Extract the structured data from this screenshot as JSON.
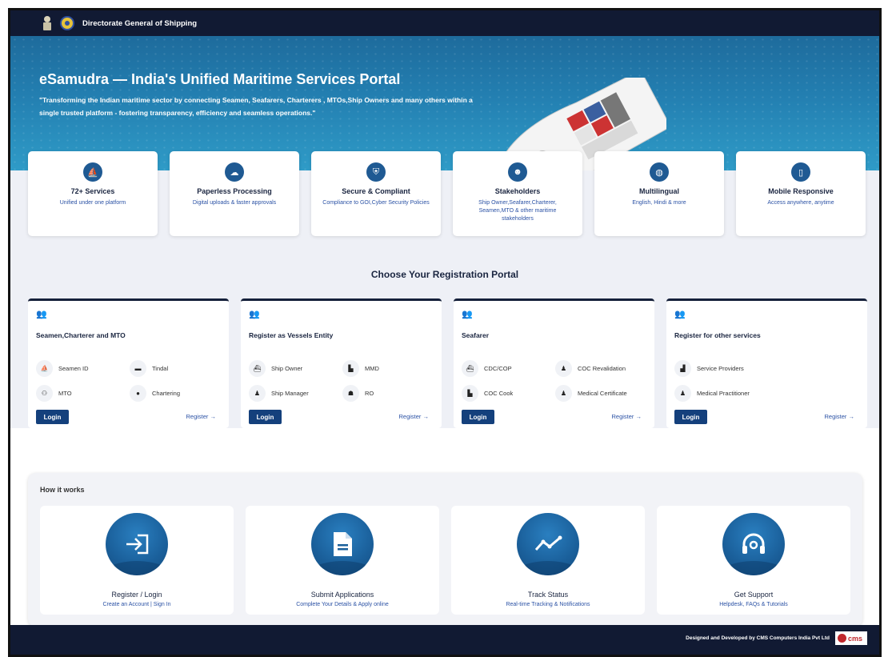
{
  "header": {
    "org_name": "Directorate General of Shipping"
  },
  "hero": {
    "title": "eSamudra — India's Unified Maritime Services Portal",
    "subtitle": "\"Transforming the Indian maritime sector by connecting Seamen, Seafarers, Charterers , MTOs,Ship Owners and many others within a single trusted platform - fostering transparency, efficiency and seamless operations.\""
  },
  "features": [
    {
      "title": "72+ Services",
      "desc": "Unified under one platform",
      "icon": "ship-icon"
    },
    {
      "title": "Paperless Processing",
      "desc": "Digital uploads & faster approvals",
      "icon": "cloud-icon"
    },
    {
      "title": "Secure & Compliant",
      "desc": "Compliance to GOI,Cyber Security Policies",
      "icon": "shield-icon"
    },
    {
      "title": "Stakeholders",
      "desc": "Ship Owner,Seafarer,Charterer, Seamen,MTO & other maritime stakeholders",
      "icon": "people-icon"
    },
    {
      "title": "Multilingual",
      "desc": "English, Hindi & more",
      "icon": "globe-icon"
    },
    {
      "title": "Mobile Responsive",
      "desc": "Access anywhere, anytime",
      "icon": "mobile-icon"
    }
  ],
  "registration": {
    "section_title": "Choose Your Registration Portal",
    "portals": [
      {
        "title": "Seamen,Charterer and MTO",
        "items": [
          "Seamen ID",
          "Tindal",
          "MTO",
          "Chartering"
        ],
        "login": "Login",
        "register": "Register →"
      },
      {
        "title": "Register as Vessels Entity",
        "items": [
          "Ship Owner",
          "MMD",
          "Ship Manager",
          "RO"
        ],
        "login": "Login",
        "register": "Register →"
      },
      {
        "title": "Seafarer",
        "items": [
          "CDC/COP",
          "COC Revalidation",
          "COC Cook",
          "Medical Certificate"
        ],
        "login": "Login",
        "register": "Register →"
      },
      {
        "title": "Register for other services",
        "items": [
          "Service Providers",
          "Medical Practitioner"
        ],
        "login": "Login",
        "register": "Register →"
      }
    ]
  },
  "how_it_works": {
    "title": "How it works",
    "steps": [
      {
        "title": "Register / Login",
        "desc": "Create an Account | Sign In",
        "icon": "login-icon"
      },
      {
        "title": "Submit Applications",
        "desc": "Complete Your Details & Apply online",
        "icon": "document-icon"
      },
      {
        "title": "Track Status",
        "desc": "Real-time Tracking & Notifications",
        "icon": "chart-line-icon"
      },
      {
        "title": "Get Support",
        "desc": "Helpdesk, FAQs & Tutorials",
        "icon": "headset-icon"
      }
    ]
  },
  "footer": {
    "credit": "Designed and Developed by CMS Computers India Pvt Ltd",
    "logo_text": "cms"
  },
  "colors": {
    "navy": "#111a33",
    "primary": "#14407c",
    "link": "#2b52a5"
  }
}
